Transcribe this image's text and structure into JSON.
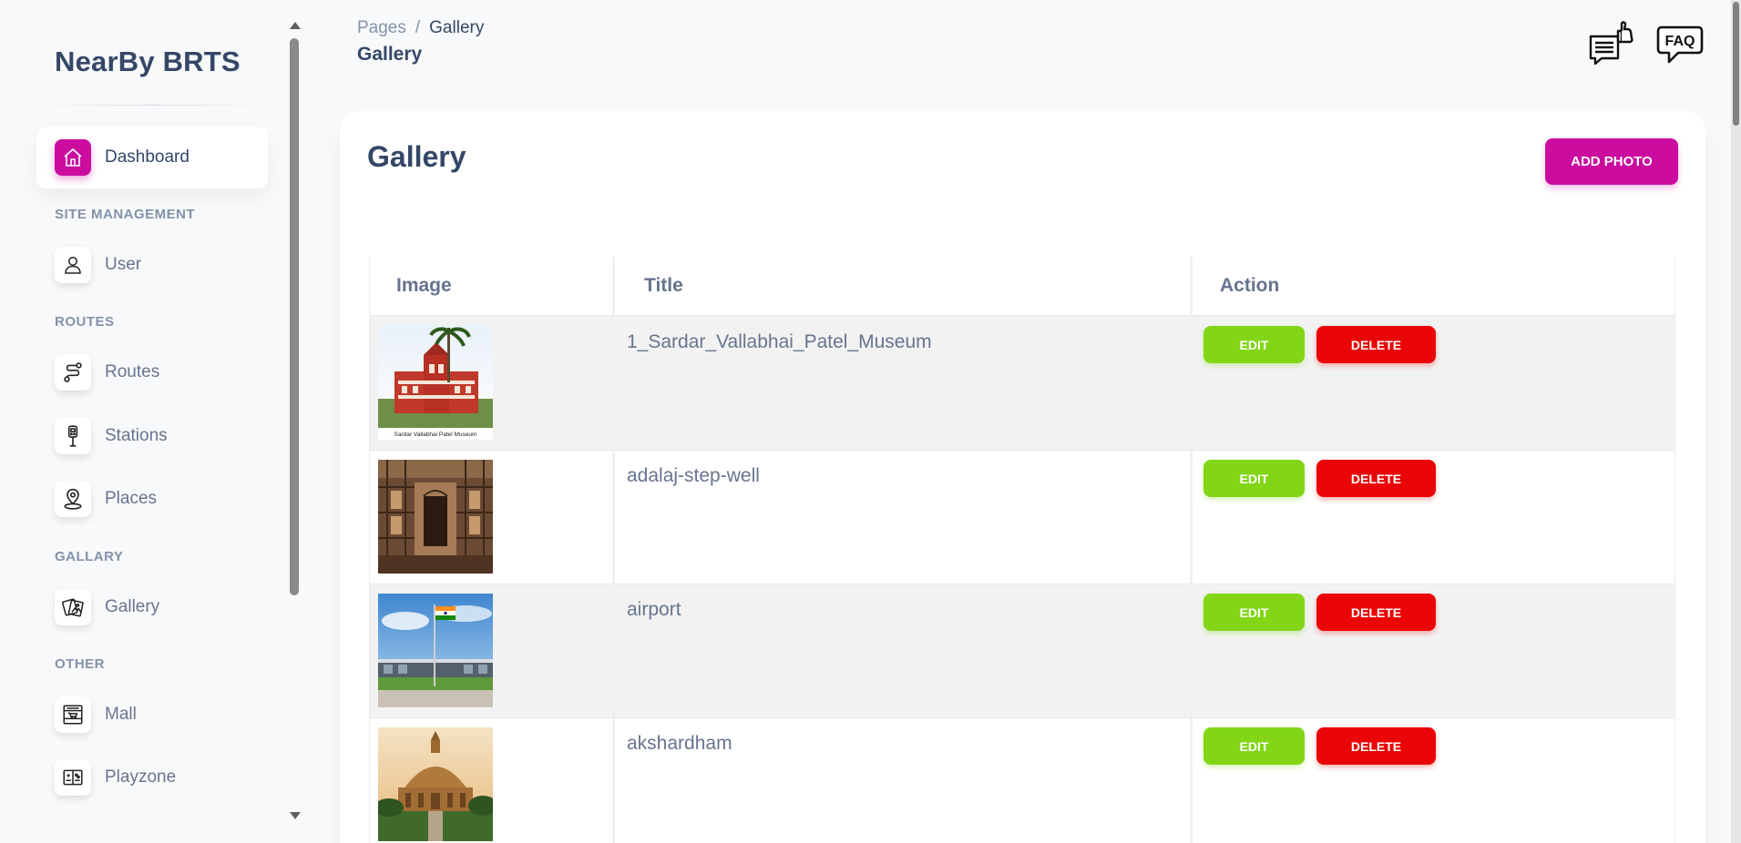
{
  "brand": "NearBy BRTS",
  "breadcrumb": {
    "parent": "Pages",
    "separator": "/",
    "current": "Gallery"
  },
  "page_title": "Gallery",
  "header_icons": [
    "feedback-icon",
    "faq-icon"
  ],
  "faq_label": "FAQ",
  "sidebar": {
    "dashboard": {
      "label": "Dashboard",
      "icon": "home-icon"
    },
    "sections": {
      "site_management": "SITE MANAGEMENT",
      "routes": "ROUTES",
      "gallary": "GALLARY",
      "other": "OTHER"
    },
    "user": {
      "label": "User",
      "icon": "user-icon"
    },
    "routes": {
      "label": "Routes",
      "icon": "route-icon"
    },
    "stations": {
      "label": "Stations",
      "icon": "bus-stop-icon"
    },
    "places": {
      "label": "Places",
      "icon": "map-pin-icon"
    },
    "gallery": {
      "label": "Gallery",
      "icon": "photos-icon"
    },
    "mall": {
      "label": "Mall",
      "icon": "shop-icon"
    },
    "playzone": {
      "label": "Playzone",
      "icon": "playzone-icon"
    }
  },
  "card": {
    "title": "Gallery",
    "add_button": "ADD PHOTO",
    "columns": {
      "image": "Image",
      "title": "Title",
      "action": "Action"
    },
    "rows": [
      {
        "title": "1_Sardar_Vallabhai_Patel_Museum",
        "image_caption": "Sardar Vallabhai Patel Museum"
      },
      {
        "title": "adalaj-step-well"
      },
      {
        "title": "airport"
      },
      {
        "title": "akshardham"
      }
    ],
    "edit_label": "EDIT",
    "delete_label": "DELETE"
  },
  "colors": {
    "primary": "#cb0c9f",
    "edit": "#82d616",
    "delete": "#ea0606",
    "text_dark": "#344767",
    "text_muted": "#67748e"
  }
}
